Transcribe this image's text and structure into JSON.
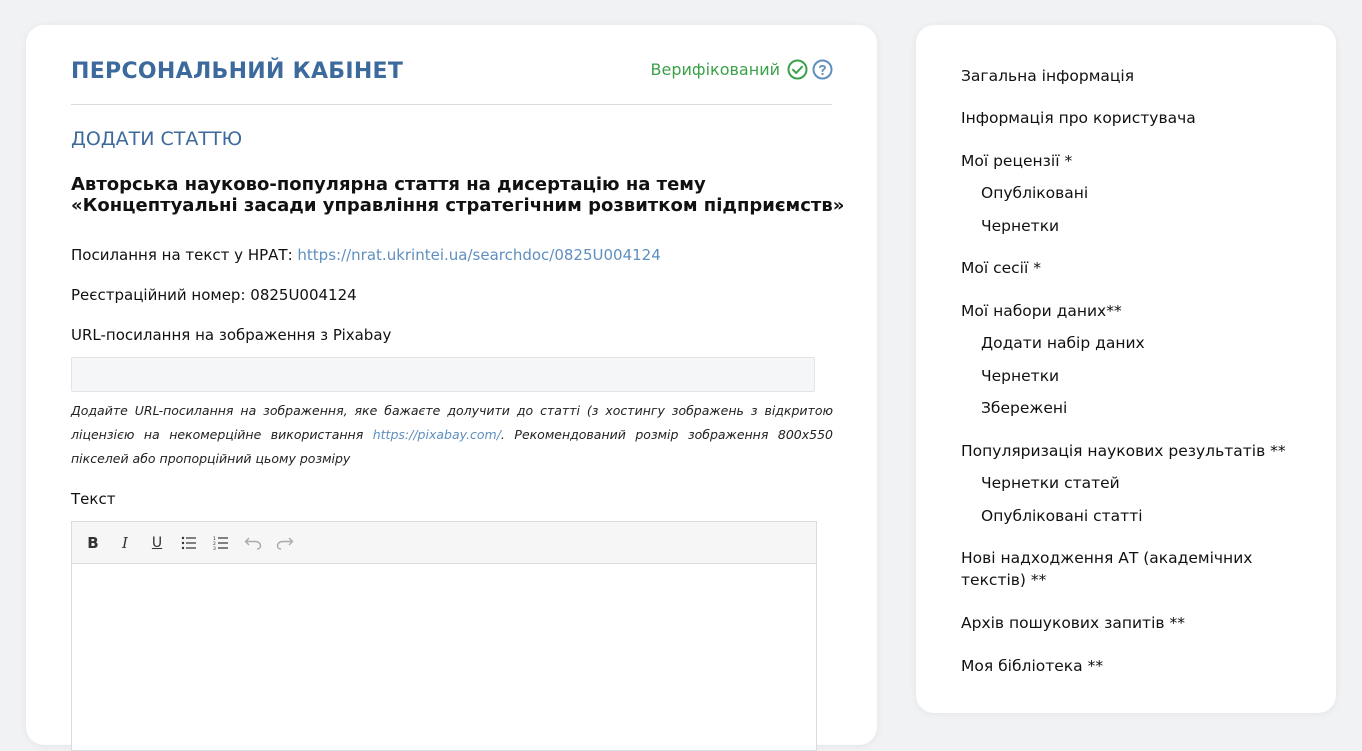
{
  "header": {
    "title": "ПЕРСОНАЛЬНИЙ КАБІНЕТ",
    "verified_label": "Верифікований",
    "verified_color": "#3aa14a",
    "accent_color": "#3d6a9c"
  },
  "form": {
    "section_title": "ДОДАТИ СТАТТЮ",
    "article_title": "Авторська науково-популярна стаття на дисертацію на тему «Концептуальні засади управління стратегічним розвитком підприємств»",
    "nrat_label": "Посилання на текст у НРАТ: ",
    "nrat_link": "https://nrat.ukrintei.ua/searchdoc/0825U004124",
    "reg_label": "Реєстраційний номер: 0825U004124",
    "image_url_label": "URL-посилання на зображення з Pixabay",
    "image_url_value": "",
    "hint_before": "Додайте URL-посилання на зображення, яке бажаєте долучити до статті (з хостингу зображень з відкритою ліцензією на некомерційне використання ",
    "hint_link": "https://pixabay.com/",
    "hint_after": ". Рекомендований розмір зображення 800x550 пікселей або пропорційний цьому розміру",
    "text_label": "Текст",
    "editor_content": "",
    "toolbar": {
      "bold": "B",
      "italic": "I",
      "underline": "U"
    }
  },
  "sidebar": {
    "items": [
      {
        "label": "Загальна інформація",
        "sub": false
      },
      {
        "label": "Інформація про користувача",
        "sub": false
      },
      {
        "label": "Мої рецензії *",
        "sub": false
      },
      {
        "label": "Опубліковані",
        "sub": true
      },
      {
        "label": "Чернетки",
        "sub": true
      },
      {
        "label": "Мої сесії *",
        "sub": false
      },
      {
        "label": "Мої набори даних**",
        "sub": false
      },
      {
        "label": "Додати набір даних",
        "sub": true
      },
      {
        "label": "Чернетки",
        "sub": true
      },
      {
        "label": "Збережені",
        "sub": true
      },
      {
        "label": "Популяризація наукових результатів **",
        "sub": false
      },
      {
        "label": "Чернетки статей",
        "sub": true
      },
      {
        "label": "Опубліковані статті",
        "sub": true
      },
      {
        "label": "Нові надходження АТ (академічних текстів) **",
        "sub": false
      },
      {
        "label": "Архів пошукових запитів **",
        "sub": false
      },
      {
        "label": "Моя бібліотека **",
        "sub": false
      }
    ]
  }
}
